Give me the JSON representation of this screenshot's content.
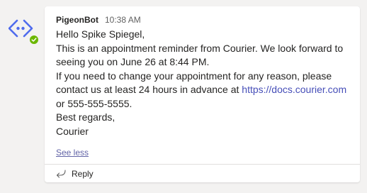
{
  "message": {
    "sender": "PigeonBot",
    "time": "10:38 AM",
    "greeting": "Hello Spike Spiegel,",
    "line1": "This is an appointment reminder from Courier. We look forward to seeing you on June 26 at 8:44 PM.",
    "line2_prefix": "If you need to change your appointment for any reason, please contact us at least 24 hours in advance at ",
    "link_text": "https://docs.courier.com",
    "line2_suffix": " or 555-555-5555.",
    "closing": "Best regards,",
    "signature": "Courier"
  },
  "actions": {
    "see_less": "See less",
    "reply": "Reply"
  },
  "colors": {
    "accent": "#6264a7",
    "presence": "#6bb700"
  },
  "icons": {
    "avatar": "code-brackets-icon",
    "presence": "checkmark-icon",
    "reply": "reply-arrow-icon"
  }
}
